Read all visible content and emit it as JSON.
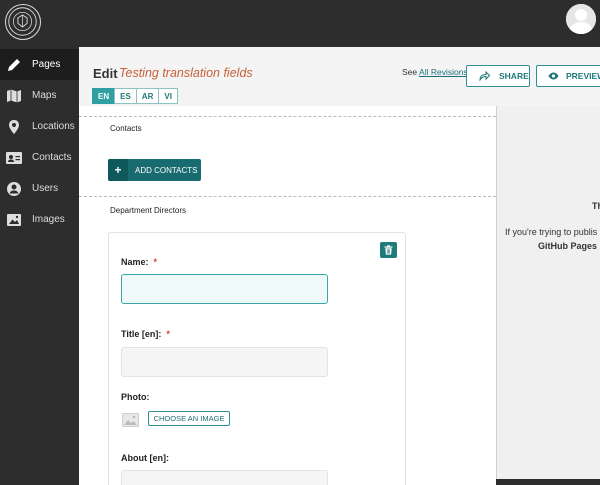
{
  "topbar": {
    "logo_icon": "city-seal-logo",
    "avatar_icon": "user-avatar"
  },
  "sidebar": {
    "items": [
      {
        "label": "Pages",
        "icon": "pencil-icon",
        "active": true
      },
      {
        "label": "Maps",
        "icon": "map-icon",
        "active": false
      },
      {
        "label": "Locations",
        "icon": "location-pin-icon",
        "active": false
      },
      {
        "label": "Contacts",
        "icon": "contact-card-icon",
        "active": false
      },
      {
        "label": "Users",
        "icon": "user-icon",
        "active": false
      },
      {
        "label": "Images",
        "icon": "image-icon",
        "active": false
      }
    ]
  },
  "header": {
    "edit_label": "Edit",
    "page_title": "Testing translation fields",
    "revisions_prefix": "See",
    "revisions_link": "All Revisions",
    "share_label": "SHARE",
    "preview_label": "PREVIEW",
    "languages": [
      "EN",
      "ES",
      "AR",
      "VI"
    ],
    "active_language": "EN"
  },
  "form": {
    "contacts_label": "Contacts",
    "add_contacts_label": "ADD CONTACTS",
    "directors_label": "Department Directors",
    "director_card": {
      "name_label": "Name:",
      "name_required": "*",
      "name_value": "",
      "title_label": "Title [en]:",
      "title_required": "*",
      "title_value": "",
      "photo_label": "Photo:",
      "choose_image_label": "CHOOSE AN IMAGE",
      "about_label": "About [en]:",
      "about_value": ""
    }
  },
  "preview_panel": {
    "line1": "Th",
    "line2": "If you're trying to publis",
    "line3": "GitHub Pages"
  },
  "colors": {
    "accent": "#2f9fa2",
    "dark_teal": "#186b6f",
    "title_orange": "#c5613a",
    "sidebar_bg": "#2d2d2d",
    "required_red": "#d0433a"
  }
}
